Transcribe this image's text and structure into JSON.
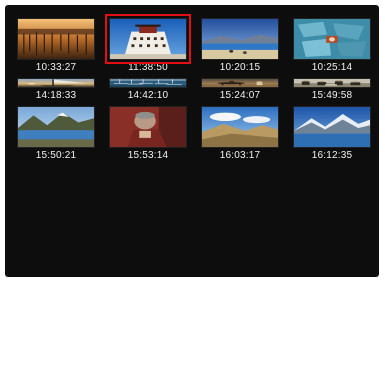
{
  "gallery": {
    "selected_index": 1,
    "accent_color": "#e10f14",
    "items": [
      {
        "time": "10:33:27",
        "icon": "sunset-landscape-photo"
      },
      {
        "time": "11:38:50",
        "icon": "palace-building-photo"
      },
      {
        "time": "10:20:15",
        "icon": "lake-shore-photo"
      },
      {
        "time": "10:25:14",
        "icon": "aerial-tents-photo"
      },
      {
        "time": "14:18:33",
        "icon": "sailboat-sunset-photo"
      },
      {
        "time": "14:42:10",
        "icon": "harbor-boats-photo"
      },
      {
        "time": "15:24:07",
        "icon": "rider-horse-photo"
      },
      {
        "time": "15:49:58",
        "icon": "people-gathering-photo"
      },
      {
        "time": "15:50:21",
        "icon": "mountain-lake-photo"
      },
      {
        "time": "15:53:14",
        "icon": "old-man-portrait-photo"
      },
      {
        "time": "16:03:17",
        "icon": "valley-clouds-photo"
      },
      {
        "time": "16:12:35",
        "icon": "snow-mountain-lake-photo"
      }
    ]
  }
}
